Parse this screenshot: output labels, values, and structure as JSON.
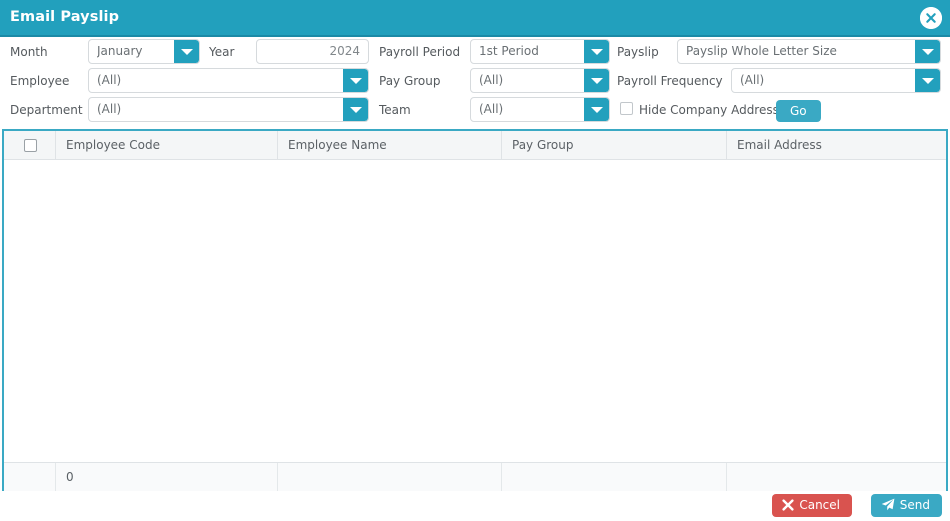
{
  "dialog": {
    "title": "Email Payslip",
    "close_icon": "close-circle-icon"
  },
  "filters": {
    "month": {
      "label": "Month",
      "value": "January",
      "icon": "chevron-down-icon"
    },
    "year": {
      "label": "Year",
      "value": "2024"
    },
    "payroll_period": {
      "label": "Payroll Period",
      "value": "1st Period",
      "icon": "chevron-down-icon"
    },
    "payslip": {
      "label": "Payslip",
      "value": "Payslip Whole Letter Size",
      "icon": "chevron-down-icon"
    },
    "employee": {
      "label": "Employee",
      "value": "(All)",
      "icon": "chevron-down-icon"
    },
    "pay_group": {
      "label": "Pay Group",
      "value": "(All)",
      "icon": "chevron-down-icon"
    },
    "payroll_frequency": {
      "label": "Payroll Frequency",
      "value": "(All)",
      "icon": "chevron-down-icon"
    },
    "department": {
      "label": "Department",
      "value": "(All)",
      "icon": "chevron-down-icon"
    },
    "team": {
      "label": "Team",
      "value": "(All)",
      "icon": "chevron-down-icon"
    },
    "hide_company_address": {
      "label": "Hide Company Address",
      "checked": false
    },
    "go": {
      "label": "Go"
    }
  },
  "grid": {
    "columns": [
      {
        "key": "select",
        "label": ""
      },
      {
        "key": "employee_code",
        "label": "Employee Code"
      },
      {
        "key": "employee_name",
        "label": "Employee Name"
      },
      {
        "key": "pay_group",
        "label": "Pay Group"
      },
      {
        "key": "email_address",
        "label": "Email Address"
      }
    ],
    "rows": [],
    "footer": {
      "select": "",
      "employee_code": "0",
      "employee_name": "",
      "pay_group": "",
      "email_address": ""
    }
  },
  "actions": {
    "cancel": {
      "label": "Cancel",
      "icon": "x-mark-icon"
    },
    "send": {
      "label": "Send",
      "icon": "paper-plane-icon"
    }
  },
  "colors": {
    "accent": "#22a0bd",
    "accent_light": "#3aa9c4",
    "danger": "#d9534f",
    "header_bg": "#f4f6f7",
    "text": "#555a5e"
  }
}
